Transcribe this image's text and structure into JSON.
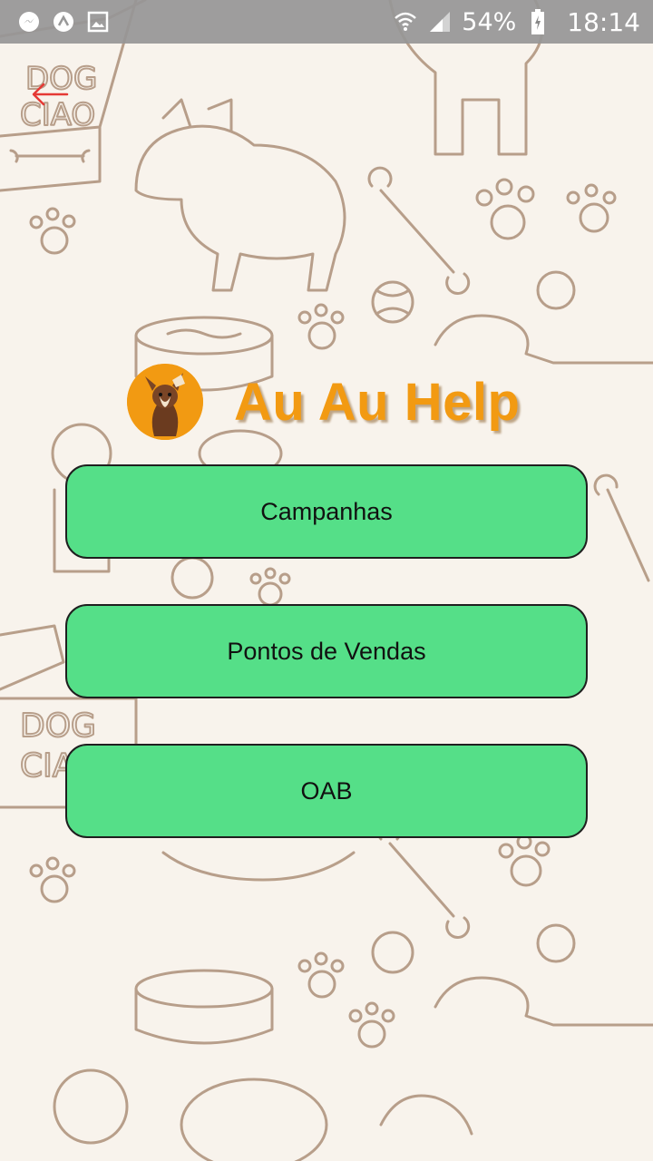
{
  "status_bar": {
    "battery": "54%",
    "time": "18:14",
    "icons": [
      "messenger-icon",
      "notification-icon",
      "gallery-icon",
      "wifi-icon",
      "signal-icon",
      "battery-charging-icon"
    ]
  },
  "header": {
    "back_icon": "arrow-left-icon",
    "back_color": "#e53935"
  },
  "brand": {
    "title": "Au Au Help",
    "logo": "dog-logo",
    "color": "#f29a12"
  },
  "menu": {
    "button_color": "#55df88",
    "items": [
      {
        "label": "Campanhas"
      },
      {
        "label": "Pontos de Vendas"
      },
      {
        "label": "OAB"
      }
    ]
  }
}
